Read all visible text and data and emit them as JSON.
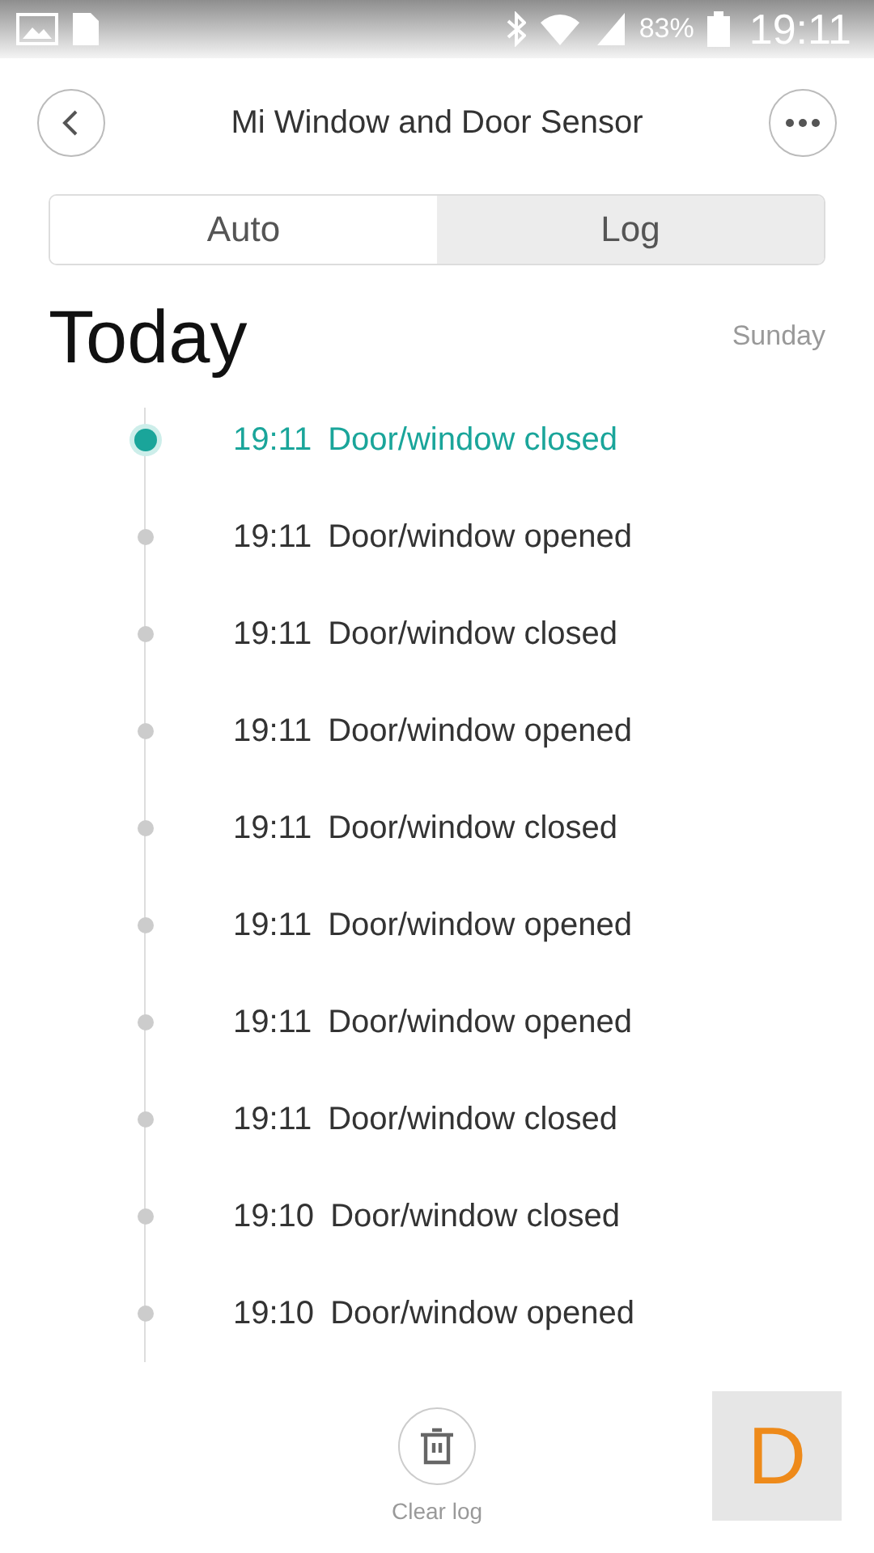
{
  "status_bar": {
    "battery": "83%",
    "time": "19:11"
  },
  "header": {
    "title": "Mi Window and Door Sensor"
  },
  "tabs": [
    {
      "label": "Auto",
      "selected": false
    },
    {
      "label": "Log",
      "selected": true
    }
  ],
  "day": {
    "title": "Today",
    "weekday": "Sunday"
  },
  "log": [
    {
      "time": "19:11",
      "event": "Door/window closed",
      "selected": true
    },
    {
      "time": "19:11",
      "event": "Door/window opened",
      "selected": false
    },
    {
      "time": "19:11",
      "event": "Door/window closed",
      "selected": false
    },
    {
      "time": "19:11",
      "event": "Door/window opened",
      "selected": false
    },
    {
      "time": "19:11",
      "event": "Door/window closed",
      "selected": false
    },
    {
      "time": "19:11",
      "event": "Door/window opened",
      "selected": false
    },
    {
      "time": "19:11",
      "event": "Door/window opened",
      "selected": false
    },
    {
      "time": "19:11",
      "event": "Door/window closed",
      "selected": false
    },
    {
      "time": "19:10",
      "event": "Door/window closed",
      "selected": false
    },
    {
      "time": "19:10",
      "event": "Door/window opened",
      "selected": false
    }
  ],
  "footer": {
    "clear_label": "Clear log"
  },
  "floating_button": {
    "label": "D"
  }
}
